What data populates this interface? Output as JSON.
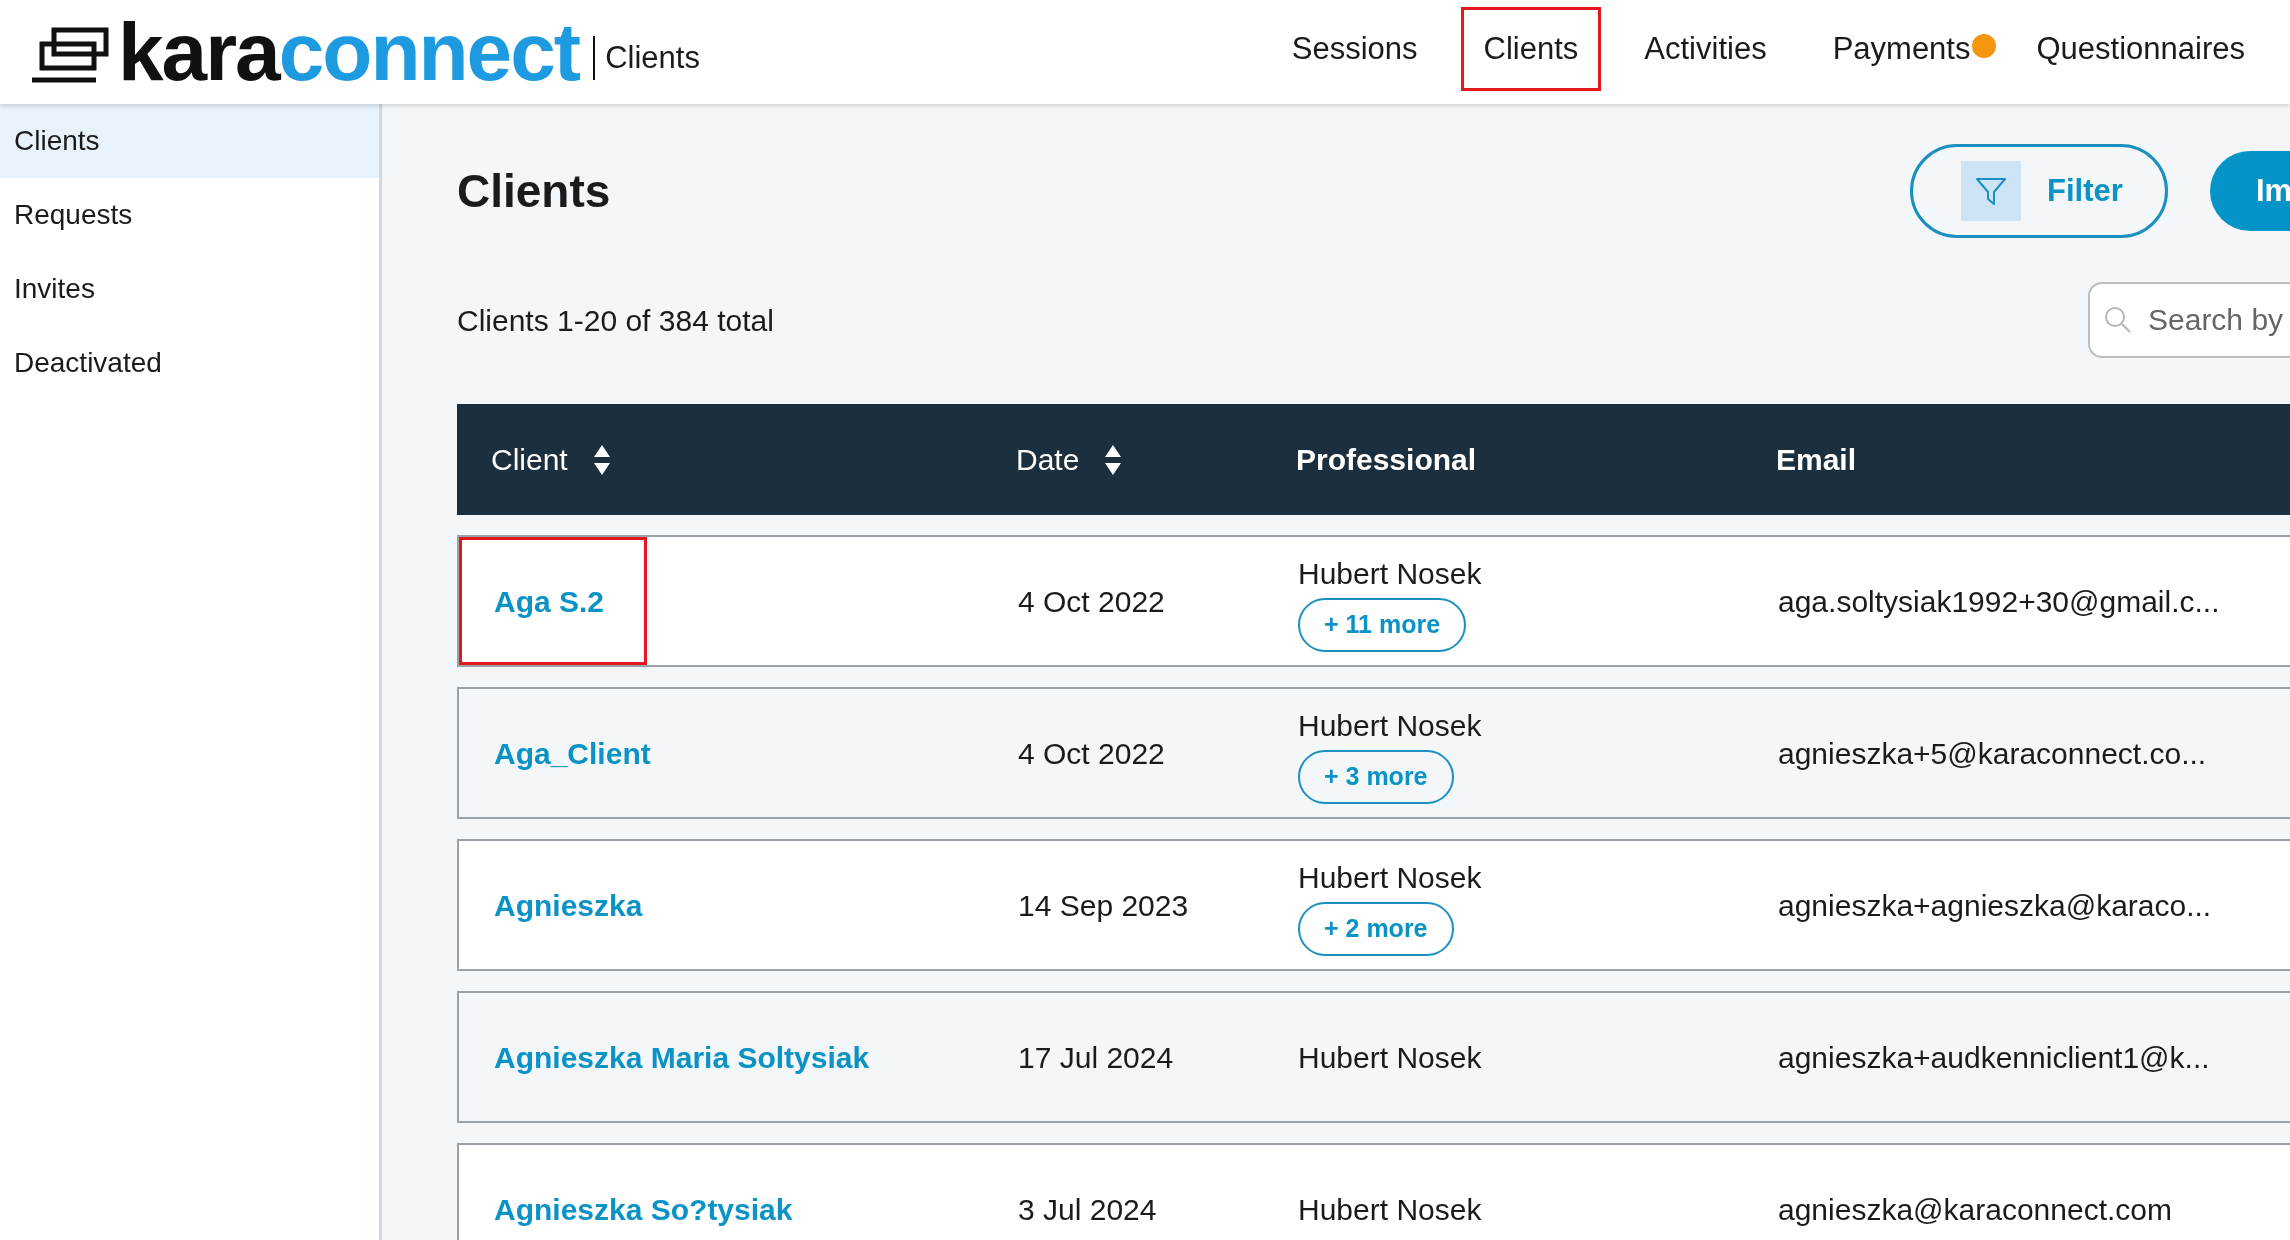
{
  "logo": {
    "dark": "kara",
    "light": "connect"
  },
  "header_section": "Clients",
  "nav": [
    {
      "label": "Sessions",
      "selected": false,
      "badge": false
    },
    {
      "label": "Clients",
      "selected": true,
      "badge": false
    },
    {
      "label": "Activities",
      "selected": false,
      "badge": false
    },
    {
      "label": "Payments",
      "selected": false,
      "badge": true
    },
    {
      "label": "Questionnaires",
      "selected": false,
      "badge": false
    }
  ],
  "sidebar": {
    "items": [
      {
        "label": "Clients",
        "selected": true
      },
      {
        "label": "Requests",
        "selected": false
      },
      {
        "label": "Invites",
        "selected": false
      },
      {
        "label": "Deactivated",
        "selected": false
      }
    ]
  },
  "title": "Clients",
  "filter_button": "Filter",
  "import_button": "Im",
  "count": "Clients 1-20 of 384 total",
  "search": {
    "placeholder": "Search by"
  },
  "table": {
    "columns": [
      {
        "label": "Client",
        "sortable": true
      },
      {
        "label": "Date",
        "sortable": true
      },
      {
        "label": "Professional",
        "sortable": false
      },
      {
        "label": "Email",
        "sortable": false
      }
    ],
    "rows": [
      {
        "client": "Aga S.2",
        "highlighted": true,
        "date": "4 Oct 2022",
        "professional": "Hubert Nosek",
        "more": "+ 11 more",
        "email": "aga.soltysiak1992+30@gmail.c..."
      },
      {
        "client": "Aga_Client",
        "highlighted": false,
        "date": "4 Oct 2022",
        "professional": "Hubert Nosek",
        "more": "+ 3 more",
        "email": "agnieszka+5@karaconnect.co..."
      },
      {
        "client": "Agnieszka",
        "highlighted": false,
        "date": "14 Sep 2023",
        "professional": "Hubert Nosek",
        "more": "+ 2 more",
        "email": "agnieszka+agnieszka@karaco..."
      },
      {
        "client": "Agnieszka Maria Soltysiak",
        "highlighted": false,
        "date": "17 Jul 2024",
        "professional": "Hubert Nosek",
        "email": "agnieszka+audkenniclient1@k..."
      },
      {
        "client": "Agnieszka So?tysiak",
        "highlighted": false,
        "date": "3 Jul 2024",
        "professional": "Hubert Nosek",
        "email": "agnieszka@karaconnect.com"
      }
    ]
  }
}
